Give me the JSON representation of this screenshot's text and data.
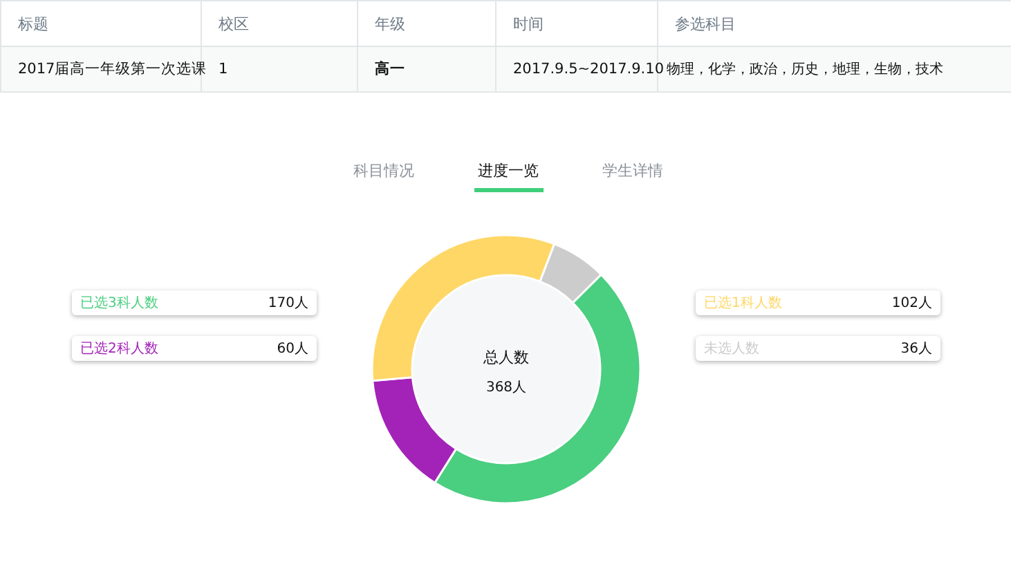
{
  "table": {
    "columns": [
      "标题",
      "校区",
      "年级",
      "时间",
      "参选科目"
    ],
    "rows": [
      [
        "2017届高一年级第一次选课",
        "1",
        "高一",
        "2017.9.5~2017.9.10",
        "物理，化学，政治，历史，地理，生物，技术"
      ]
    ]
  },
  "tabs": [
    {
      "label": "科目情况",
      "selected": false
    },
    {
      "label": "进度一览",
      "selected": true
    },
    {
      "label": "学生详情",
      "selected": false
    }
  ],
  "legend": [
    {
      "label": "已选3科人数",
      "count": "170人",
      "color": "#4ace80"
    },
    {
      "label": "已选2科人数",
      "count": "60人",
      "color": "#a323b8"
    },
    {
      "label": "已选1科人数",
      "count": "102人",
      "color": "#ffd766"
    },
    {
      "label": "未选人数",
      "count": "36人",
      "color": "#cccccc"
    }
  ],
  "center": {
    "title": "总人数",
    "total": "368人"
  },
  "chart_data": {
    "type": "donut",
    "values": [
      6.7,
      46.4,
      14.7,
      32.2
    ],
    "colors": [
      "#cccccc",
      "#4ace80",
      "#a323b8",
      "#ffd766"
    ]
  }
}
